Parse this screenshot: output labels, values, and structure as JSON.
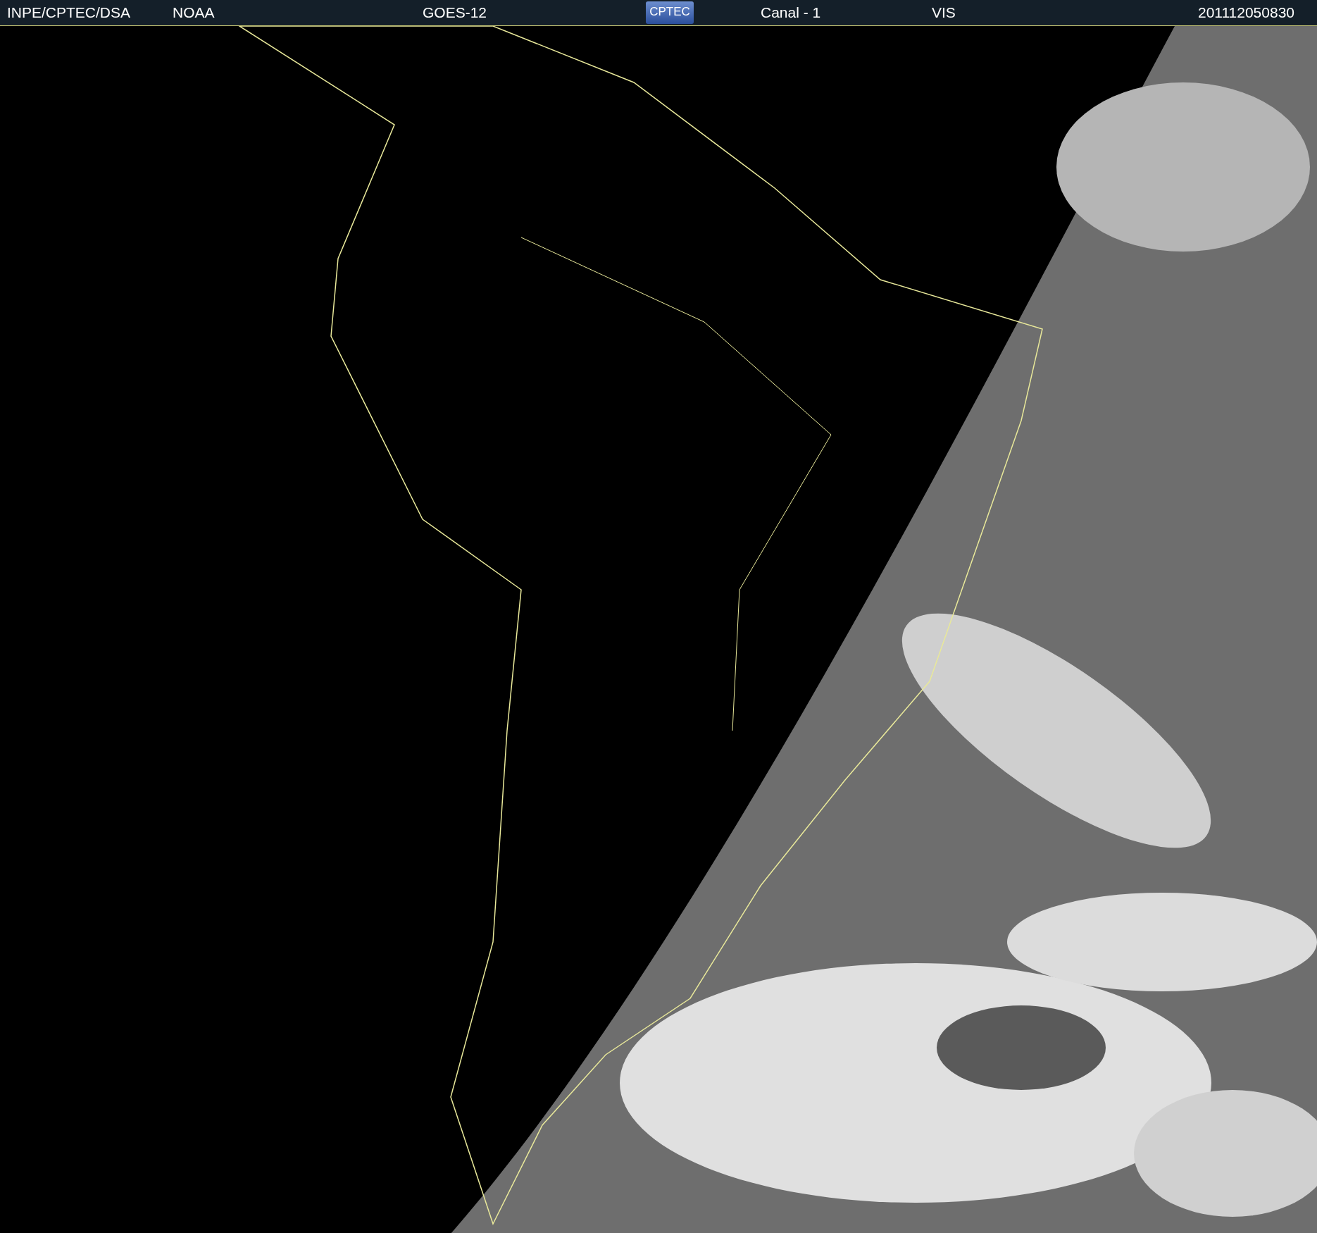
{
  "header": {
    "institution": "INPE/CPTEC/DSA",
    "agency": "NOAA",
    "satellite": "GOES-12",
    "logo": "CPTEC",
    "channel": "Canal - 1",
    "band": "VIS",
    "timestamp": "201112050830"
  }
}
